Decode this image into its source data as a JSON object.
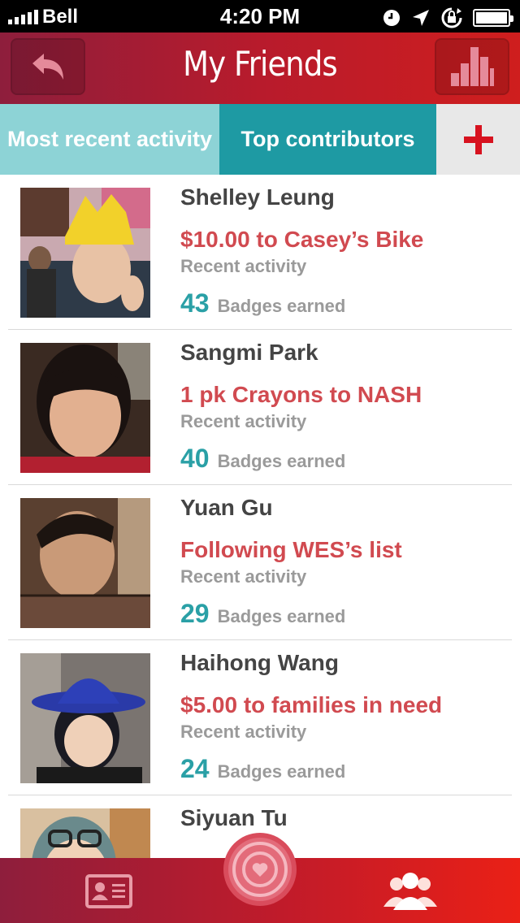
{
  "status_bar": {
    "carrier": "Bell",
    "time": "4:20 PM"
  },
  "nav": {
    "title": "My Friends",
    "back_icon": "reply-arrow-icon",
    "chart_icon": "bar-chart-icon"
  },
  "tabs": {
    "recent_label": "Most recent activity",
    "top_label": "Top contributors",
    "selected": "Top contributors",
    "add_icon": "plus-icon"
  },
  "friends": [
    {
      "name": "Shelley Leung",
      "activity": "$10.00 to Casey’s Bike",
      "activity_label": "Recent activity",
      "badges": "43",
      "badges_label": "Badges earned"
    },
    {
      "name": "Sangmi Park",
      "activity": "1 pk Crayons to NASH",
      "activity_label": "Recent activity",
      "badges": "40",
      "badges_label": "Badges earned"
    },
    {
      "name": "Yuan Gu",
      "activity": "Following WES’s list",
      "activity_label": "Recent activity",
      "badges": "29",
      "badges_label": "Badges earned"
    },
    {
      "name": "Haihong Wang",
      "activity": "$5.00 to families in need",
      "activity_label": "Recent activity",
      "badges": "24",
      "badges_label": "Badges earned"
    },
    {
      "name": "Siyuan Tu",
      "activity": "",
      "activity_label": "",
      "badges": "",
      "badges_label": ""
    }
  ],
  "tab_bar": {
    "profile_icon": "id-card-icon",
    "center_icon": "heart-target-icon",
    "friends_icon": "people-icon"
  },
  "colors": {
    "nav_red": "#b81b2c",
    "teal": "#1e9aa3",
    "light_teal": "#8dd3d6",
    "activity_red": "#d14a50"
  }
}
